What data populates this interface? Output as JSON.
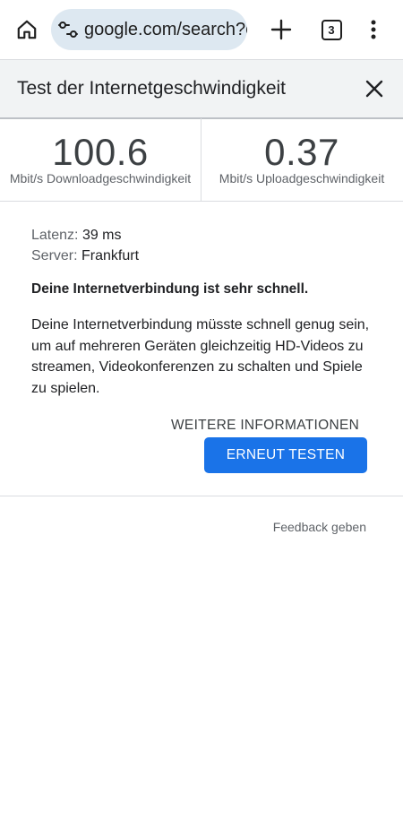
{
  "browser": {
    "url": "google.com/search?q",
    "tab_count": "3"
  },
  "sheet": {
    "title": "Test der Internetgeschwindigkeit"
  },
  "download": {
    "value": "100.6",
    "unit": "Mbit/s Downloadgeschwindigkeit"
  },
  "upload": {
    "value": "0.37",
    "unit": "Mbit/s Uploadgeschwindigkeit"
  },
  "details": {
    "latency_label": "Latenz:",
    "latency_value": "39 ms",
    "server_label": "Server:",
    "server_value": "Frankfurt"
  },
  "headline": "Deine Internetverbindung ist sehr schnell.",
  "description": "Deine Internetverbindung müsste schnell genug sein, um auf mehreren Geräten gleichzeitig HD-Videos zu streamen, Videokonferenzen zu schalten und Spiele zu spielen.",
  "actions": {
    "more_info": "WEITERE INFORMATIONEN",
    "retest": "ERNEUT TESTEN",
    "feedback": "Feedback geben"
  },
  "colors": {
    "accent": "#1a73e8",
    "omnibox_bg": "#dde8f1",
    "header_bg": "#f1f3f4"
  }
}
